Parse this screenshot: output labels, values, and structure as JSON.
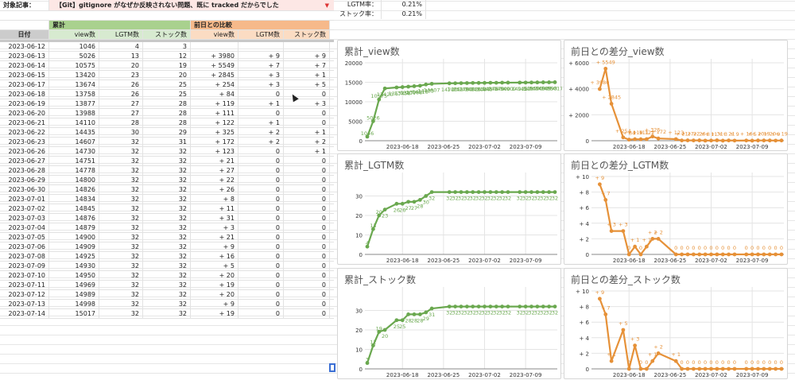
{
  "sheet": {
    "article_label": "対象記事：",
    "article_title": "【Git】gitignore がなぜか反映されない問題、既に tracked だからでした",
    "group_cumulative": "累計",
    "group_diff": "前日との比較",
    "headers": [
      "日付",
      "view数",
      "LGTM数",
      "ストック数",
      "view数",
      "LGTM数",
      "ストック数"
    ],
    "rows": [
      [
        "2023-06-12",
        "1046",
        "4",
        "3",
        "",
        "",
        ""
      ],
      [
        "2023-06-13",
        "5026",
        "13",
        "12",
        "+ 3980",
        "+ 9",
        "+ 9"
      ],
      [
        "2023-06-14",
        "10575",
        "20",
        "19",
        "+ 5549",
        "+ 7",
        "+ 7"
      ],
      [
        "2023-06-15",
        "13420",
        "23",
        "20",
        "+ 2845",
        "+ 3",
        "+ 1"
      ],
      [
        "2023-06-17",
        "13674",
        "26",
        "25",
        "+ 254",
        "+ 3",
        "+ 5"
      ],
      [
        "2023-06-18",
        "13758",
        "26",
        "25",
        "+ 84",
        "0",
        "0"
      ],
      [
        "2023-06-19",
        "13877",
        "27",
        "28",
        "+ 119",
        "+ 1",
        "+ 3"
      ],
      [
        "2023-06-20",
        "13988",
        "27",
        "28",
        "+ 111",
        "0",
        "0"
      ],
      [
        "2023-06-21",
        "14110",
        "28",
        "28",
        "+ 122",
        "+ 1",
        "0"
      ],
      [
        "2023-06-22",
        "14435",
        "30",
        "29",
        "+ 325",
        "+ 2",
        "+ 1"
      ],
      [
        "2023-06-23",
        "14607",
        "32",
        "31",
        "+ 172",
        "+ 2",
        "+ 2"
      ],
      [
        "2023-06-26",
        "14730",
        "32",
        "32",
        "+ 123",
        "0",
        "+ 1"
      ],
      [
        "2023-06-27",
        "14751",
        "32",
        "32",
        "+ 21",
        "0",
        "0"
      ],
      [
        "2023-06-28",
        "14778",
        "32",
        "32",
        "+ 27",
        "0",
        "0"
      ],
      [
        "2023-06-29",
        "14800",
        "32",
        "32",
        "+ 22",
        "0",
        "0"
      ],
      [
        "2023-06-30",
        "14826",
        "32",
        "32",
        "+ 26",
        "0",
        "0"
      ],
      [
        "2023-07-01",
        "14834",
        "32",
        "32",
        "+ 8",
        "0",
        "0"
      ],
      [
        "2023-07-02",
        "14845",
        "32",
        "32",
        "+ 11",
        "0",
        "0"
      ],
      [
        "2023-07-03",
        "14876",
        "32",
        "32",
        "+ 31",
        "0",
        "0"
      ],
      [
        "2023-07-04",
        "14879",
        "32",
        "32",
        "+ 3",
        "0",
        "0"
      ],
      [
        "2023-07-05",
        "14900",
        "32",
        "32",
        "+ 21",
        "0",
        "0"
      ],
      [
        "2023-07-06",
        "14909",
        "32",
        "32",
        "+ 9",
        "0",
        "0"
      ],
      [
        "2023-07-08",
        "14925",
        "32",
        "32",
        "+ 16",
        "0",
        "0"
      ],
      [
        "2023-07-09",
        "14930",
        "32",
        "32",
        "+ 5",
        "0",
        "0"
      ],
      [
        "2023-07-10",
        "14950",
        "32",
        "32",
        "+ 20",
        "0",
        "0"
      ],
      [
        "2023-07-11",
        "14969",
        "32",
        "32",
        "+ 19",
        "0",
        "0"
      ],
      [
        "2023-07-12",
        "14989",
        "32",
        "32",
        "+ 20",
        "0",
        "0"
      ],
      [
        "2023-07-13",
        "14998",
        "32",
        "32",
        "+ 9",
        "0",
        "0"
      ],
      [
        "2023-07-14",
        "15017",
        "32",
        "32",
        "+ 19",
        "0",
        "0"
      ]
    ]
  },
  "stats": {
    "lgtm_rate_label": "LGTM率：",
    "lgtm_rate": "0.21%",
    "stock_rate_label": "ストック率：",
    "stock_rate": "0.21%"
  },
  "colors": {
    "green": "#6aa84f",
    "orange": "#e69138",
    "grid": "#e4e4e4"
  },
  "chart_data": [
    {
      "type": "line",
      "title": "累計_view数",
      "color": "green",
      "column": 1,
      "diff": false,
      "ylim": [
        0,
        20000
      ],
      "yticks": [
        "0",
        "5000",
        "10000",
        "15000",
        "20000"
      ],
      "xticks": [
        "2023-06-18",
        "2023-06-25",
        "2023-07-02",
        "2023-07-09"
      ]
    },
    {
      "type": "line",
      "title": "前日との差分_view数",
      "color": "orange",
      "column": 4,
      "diff": true,
      "ylim": [
        0,
        6000
      ],
      "yticks": [
        "0",
        "+ 2000",
        "+ 4000",
        "+ 6000"
      ],
      "xticks": [
        "2023-06-18",
        "2023-06-25",
        "2023-07-02",
        "2023-07-09"
      ]
    },
    {
      "type": "line",
      "title": "累計_LGTM数",
      "color": "green",
      "column": 2,
      "diff": false,
      "ylim": [
        0,
        40
      ],
      "yticks": [
        "0",
        "10",
        "20",
        "30"
      ],
      "xticks": [
        "2023-06-18",
        "2023-06-25",
        "2023-07-02",
        "2023-07-09"
      ]
    },
    {
      "type": "line",
      "title": "前日との差分_LGTM数",
      "color": "orange",
      "column": 5,
      "diff": true,
      "ylim": [
        0,
        10
      ],
      "yticks": [
        "0",
        "+ 2",
        "+ 4",
        "+ 6",
        "+ 8",
        "+ 10"
      ],
      "xticks": [
        "2023-06-18",
        "2023-06-25",
        "2023-07-02",
        "2023-07-09"
      ]
    },
    {
      "type": "line",
      "title": "累計_ストック数",
      "color": "green",
      "column": 3,
      "diff": false,
      "ylim": [
        0,
        40
      ],
      "yticks": [
        "0",
        "10",
        "20",
        "30"
      ],
      "xticks": [
        "2023-06-18",
        "2023-06-25",
        "2023-07-02",
        "2023-07-09"
      ]
    },
    {
      "type": "line",
      "title": "前日との差分_ストック数",
      "color": "orange",
      "column": 6,
      "diff": true,
      "ylim": [
        0,
        10
      ],
      "yticks": [
        "0",
        "+ 2",
        "+ 4",
        "+ 6",
        "+ 8",
        "+ 10"
      ],
      "xticks": [
        "2023-06-18",
        "2023-06-25",
        "2023-07-02",
        "2023-07-09"
      ]
    }
  ]
}
